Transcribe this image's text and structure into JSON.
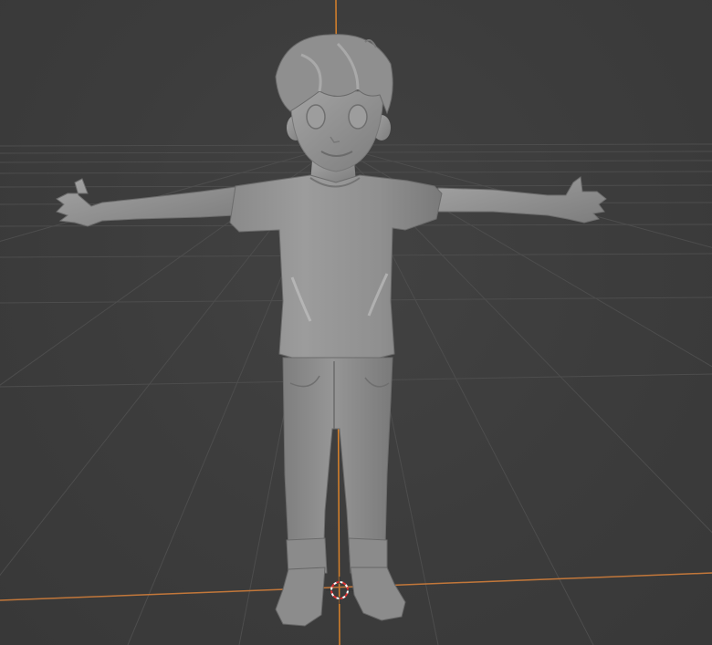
{
  "viewport": {
    "background_color": "#3d3d3d",
    "grid_line_color": "#4d4d4d",
    "x_axis_color": "#c2773a",
    "z_axis_color": "#d9822b",
    "object_color": "#8e8e8e",
    "shading": "solid-matcap-gray",
    "object_name": "boy-character",
    "pose": "t-pose"
  },
  "icons": {
    "origin": "3d-cursor-icon"
  }
}
